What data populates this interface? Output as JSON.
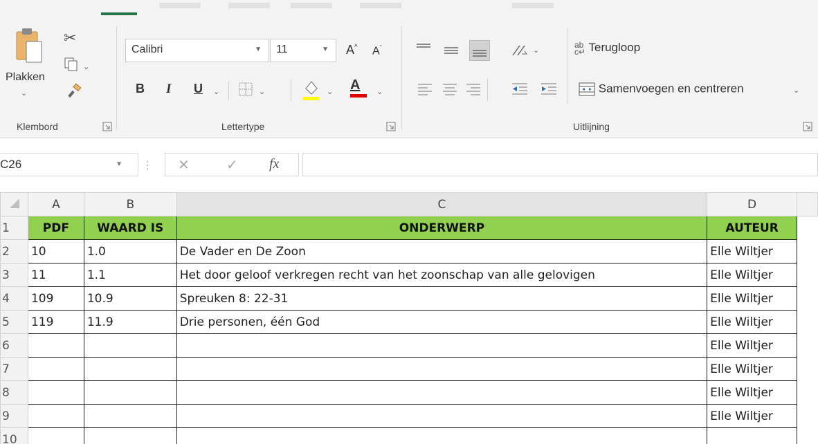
{
  "ribbon": {
    "clipboard": {
      "paste_label": "Plakken",
      "group_label": "Klembord",
      "cut_icon": "scissors-icon",
      "copy_icon": "copy-icon",
      "format_painter_icon": "paintbrush-icon"
    },
    "font": {
      "font_name": "Calibri",
      "font_size": "11",
      "group_label": "Lettertype",
      "grow_label": "A",
      "shrink_label": "A",
      "bold_label": "B",
      "italic_label": "I",
      "underline_label": "U",
      "font_color_label": "A",
      "highlight_color": "#ffff00",
      "font_color": "#e00000"
    },
    "alignment": {
      "wrap_label": "Terugloop",
      "merge_label": "Samenvoegen en centreren",
      "group_label": "Uitlijning"
    }
  },
  "formula_bar": {
    "name_box": "C26",
    "fx_label": "fx",
    "formula": ""
  },
  "grid": {
    "columns": [
      "A",
      "B",
      "C",
      "D"
    ],
    "row_numbers": [
      "1",
      "2",
      "3",
      "4",
      "5",
      "6",
      "7",
      "8",
      "9",
      "10"
    ],
    "header_row": [
      "PDF",
      "WAARD IS",
      "ONDERWERP",
      "AUTEUR"
    ],
    "rows": [
      [
        "10",
        "1.0",
        "De Vader en De Zoon",
        "Elle Wiltjer"
      ],
      [
        "11",
        "1.1",
        "Het door geloof verkregen recht van het zoonschap van alle gelovigen",
        "Elle Wiltjer"
      ],
      [
        "109",
        "10.9",
        "Spreuken 8: 22-31",
        "Elle Wiltjer"
      ],
      [
        "119",
        "11.9",
        "Drie personen, één God",
        "Elle Wiltjer"
      ],
      [
        "",
        "",
        "",
        "Elle Wiltjer"
      ],
      [
        "",
        "",
        "",
        "Elle Wiltjer"
      ],
      [
        "",
        "",
        "",
        "Elle Wiltjer"
      ],
      [
        "",
        "",
        "",
        "Elle Wiltjer"
      ],
      [
        "",
        "",
        "",
        ""
      ]
    ],
    "header_fill": "#92d050"
  }
}
